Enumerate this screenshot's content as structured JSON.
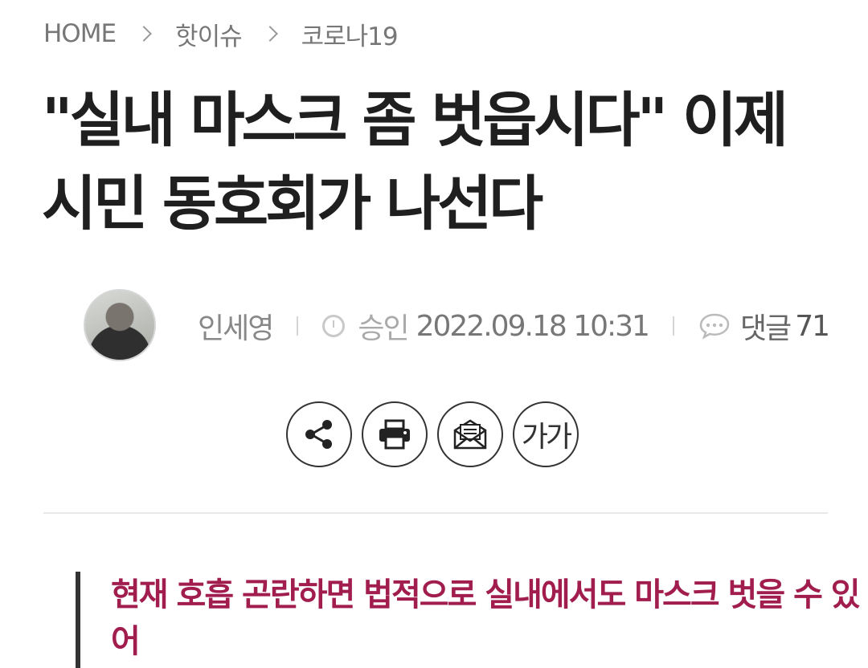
{
  "breadcrumb": {
    "home": "HOME",
    "section": "핫이슈",
    "topic": "코로나19"
  },
  "article": {
    "title_line1": "\"실내 마스크 좀 벗읍시다\" 이제",
    "title_line2": "시민 동호회가 나선다",
    "author": "인세영",
    "approved_label": "승인",
    "datetime": "2022.09.18 10:31",
    "comments_label": "댓글",
    "comments_count": "71",
    "summary": "현재 호흡 곤란하면 법적으로 실내에서도 마스크 벗을 수 있어"
  },
  "share": {
    "font_label": "가가"
  },
  "icons": {
    "share": "share-icon",
    "print": "print-icon",
    "email": "email-icon",
    "comment": "comment-icon",
    "clock": "clock-icon"
  },
  "colors": {
    "summary_accent": "#a11d4d",
    "title": "#1f1f1f",
    "meta": "#999999"
  }
}
